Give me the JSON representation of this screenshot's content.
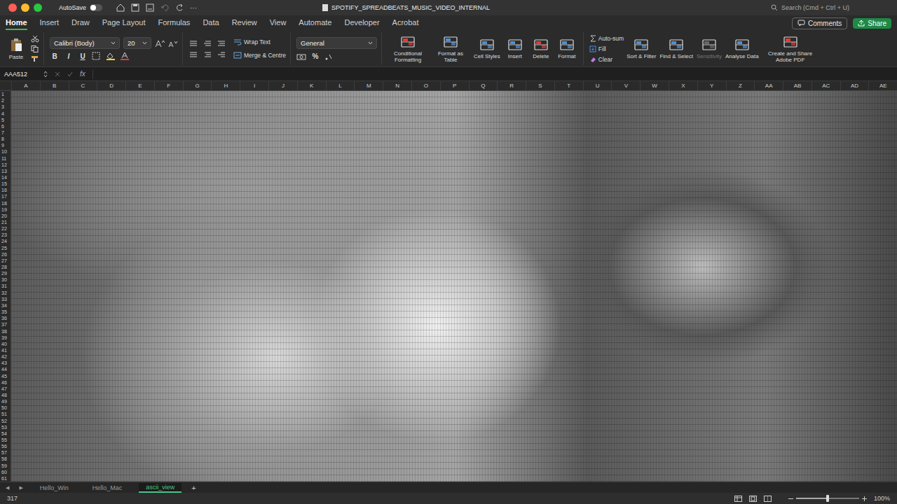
{
  "window": {
    "title": "SPOTIFY_SPREADBEATS_MUSIC_VIDEO_INTERNAL",
    "autosave": {
      "label": "AutoSave",
      "on": false
    },
    "more": "···",
    "search": "Search (Cmd + Ctrl + U)"
  },
  "menu_tabs": [
    {
      "label": "Home",
      "selected": true
    },
    {
      "label": "Insert",
      "selected": false
    },
    {
      "label": "Draw",
      "selected": false
    },
    {
      "label": "Page Layout",
      "selected": false
    },
    {
      "label": "Formulas",
      "selected": false
    },
    {
      "label": "Data",
      "selected": false
    },
    {
      "label": "Review",
      "selected": false
    },
    {
      "label": "View",
      "selected": false
    },
    {
      "label": "Automate",
      "selected": false
    },
    {
      "label": "Developer",
      "selected": false
    },
    {
      "label": "Acrobat",
      "selected": false
    }
  ],
  "header_buttons": {
    "comments": "Comments",
    "share": "Share"
  },
  "ribbon": {
    "paste": "Paste",
    "font_name": "Calibri (Body)",
    "font_size": "20",
    "styles": [
      "B",
      "I",
      "U"
    ],
    "wrap": "Wrap Text",
    "merge": "Merge & Centre",
    "number_format": "General",
    "number_symbols": [
      "%"
    ],
    "large_a": [
      {
        "label": "Conditional Formatting",
        "disabled": false
      },
      {
        "label": "Format as Table",
        "disabled": false
      },
      {
        "label": "Cell Styles",
        "disabled": false
      },
      {
        "label": "Insert",
        "disabled": false
      },
      {
        "label": "Delete",
        "disabled": false
      },
      {
        "label": "Format",
        "disabled": false
      }
    ],
    "editing": [
      "Auto-sum",
      "Fill",
      "Clear"
    ],
    "large_b": [
      {
        "label": "Sort & Filter",
        "disabled": false
      },
      {
        "label": "Find & Select",
        "disabled": false
      },
      {
        "label": "Sensitivity",
        "disabled": true
      },
      {
        "label": "Analyse Data",
        "disabled": false
      },
      {
        "label": "Create and Share Adobe PDF",
        "disabled": false
      }
    ]
  },
  "formula_bar": {
    "name_box": "AAA512",
    "fx": "fx"
  },
  "columns": [
    "A",
    "B",
    "C",
    "D",
    "E",
    "F",
    "G",
    "H",
    "I",
    "J",
    "K",
    "L",
    "M",
    "N",
    "O",
    "P",
    "Q",
    "R",
    "S",
    "T",
    "U",
    "V",
    "W",
    "X",
    "Y",
    "Z",
    "AA",
    "AB",
    "AC",
    "AD",
    "AE"
  ],
  "rows": [
    "1",
    "2",
    "3",
    "4",
    "5",
    "6",
    "7",
    "8",
    "9",
    "10",
    "11",
    "12",
    "13",
    "14",
    "15",
    "16",
    "17",
    "18",
    "19",
    "20",
    "21",
    "22",
    "23",
    "24",
    "25",
    "26",
    "27",
    "28",
    "29",
    "30",
    "31",
    "32",
    "33",
    "34",
    "35",
    "36",
    "37",
    "38",
    "39",
    "40",
    "41",
    "42",
    "43",
    "44",
    "45",
    "46",
    "47",
    "48",
    "49",
    "50",
    "51",
    "52",
    "53",
    "54",
    "55",
    "56",
    "57",
    "58",
    "59",
    "60",
    "61"
  ],
  "sheet_nav": [
    "◀",
    "▶"
  ],
  "sheets": [
    {
      "label": "Hello_Win",
      "selected": false
    },
    {
      "label": "Hello_Mac",
      "selected": false
    },
    {
      "label": "ascii_view",
      "selected": true
    }
  ],
  "add_sheet": "+",
  "status_bar": {
    "left": "317",
    "zoom": "100%",
    "zoom_level": 0.5
  }
}
